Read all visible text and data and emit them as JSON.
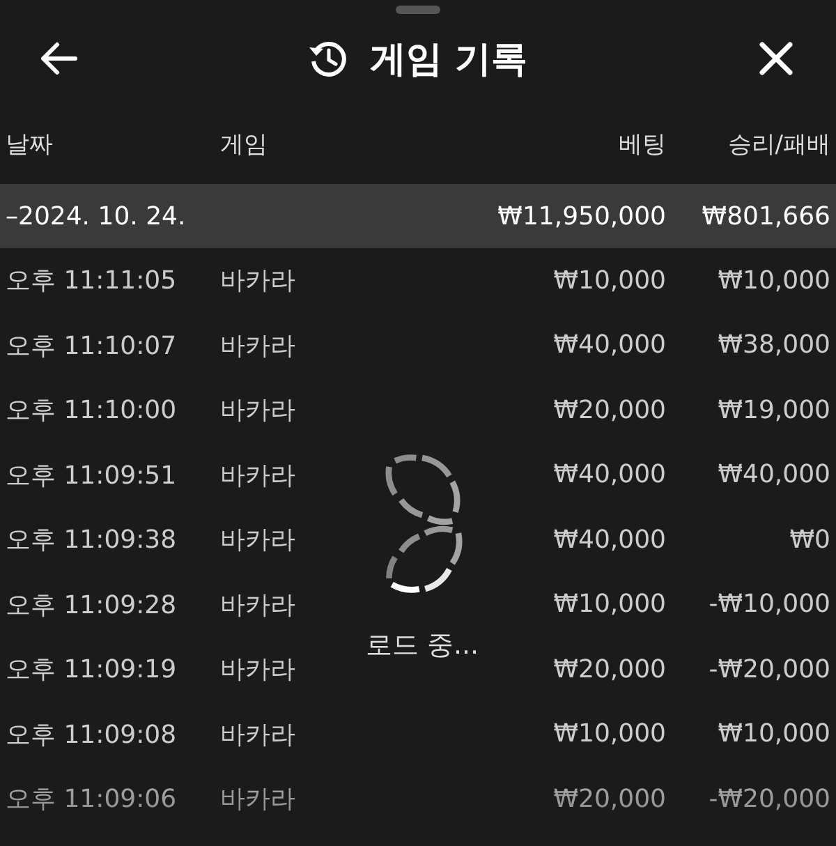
{
  "header": {
    "title": "게임 기록"
  },
  "columns": [
    "날짜",
    "게임",
    "베팅",
    "승리/패배"
  ],
  "group": {
    "date": "–2024. 10. 24.",
    "bet": "₩11,950,000",
    "result": "₩801,666"
  },
  "rows": [
    {
      "time": "오후 11:11:05",
      "game": "바카라",
      "bet": "₩10,000",
      "result": "₩10,000"
    },
    {
      "time": "오후 11:10:07",
      "game": "바카라",
      "bet": "₩40,000",
      "result": "₩38,000"
    },
    {
      "time": "오후 11:10:00",
      "game": "바카라",
      "bet": "₩20,000",
      "result": "₩19,000"
    },
    {
      "time": "오후 11:09:51",
      "game": "바카라",
      "bet": "₩40,000",
      "result": "₩40,000"
    },
    {
      "time": "오후 11:09:38",
      "game": "바카라",
      "bet": "₩40,000",
      "result": "₩0"
    },
    {
      "time": "오후 11:09:28",
      "game": "바카라",
      "bet": "₩10,000",
      "result": "-₩10,000"
    },
    {
      "time": "오후 11:09:19",
      "game": "바카라",
      "bet": "₩20,000",
      "result": "-₩20,000"
    },
    {
      "time": "오후 11:09:08",
      "game": "바카라",
      "bet": "₩10,000",
      "result": "₩10,000"
    },
    {
      "time": "오후 11:09:06",
      "game": "바카라",
      "bet": "₩20,000",
      "result": "-₩20,000"
    }
  ],
  "loading": {
    "label": "로드 중..."
  }
}
